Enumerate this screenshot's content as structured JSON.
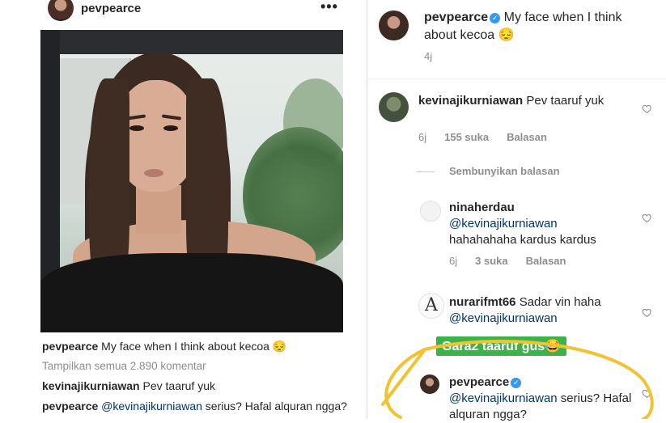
{
  "post": {
    "username": "pevpearce",
    "more_label": "•••",
    "caption_user": "pevpearce",
    "caption_text": "My face when I think about kecoa 😔",
    "view_all": "Tampilkan semua 2.890 komentar",
    "comment1_user": "kevinajikurniawan",
    "comment1_text": "Pev taaruf yuk",
    "comment2_user": "pevpearce",
    "comment2_mention": "@kevinajikurniawan",
    "comment2_text": "serius? Hafal alquran ngga?"
  },
  "thread": {
    "post_user": "pevpearce",
    "post_text": "My face when I think about kecoa 😔",
    "post_time": "4j",
    "kevin": {
      "user": "kevinajikurniawan",
      "text": "Pev taaruf yuk",
      "time": "6j",
      "likes": "155 suka",
      "reply": "Balasan"
    },
    "hide_replies": "Sembunyikan balasan",
    "nina": {
      "user": "ninaherdau",
      "mention": "@kevinajikurniawan",
      "text": "hahahahaha kardus kardus",
      "time": "6j",
      "likes": "3 suka",
      "reply": "Balasan"
    },
    "nurar": {
      "user": "nurarifmt66",
      "text": "Sadar vin haha",
      "mention": "@kevinajikurniawan",
      "avatar_letter": "A"
    },
    "pev_reply": {
      "user": "pevpearce",
      "mention": "@kevinajikurniawan",
      "text": "serius? Hafal alquran ngga?"
    }
  },
  "sticker_text": "Gara2 taaruf gus😂",
  "colors": {
    "mention": "#003569",
    "verified": "#3897f0",
    "sticker_bg": "#3cb34a",
    "highlight": "#f2c230",
    "meta": "#8e8e8e"
  },
  "icons": {
    "heart": "heart-icon",
    "verified": "verified-badge-icon",
    "more": "more-options-icon"
  }
}
